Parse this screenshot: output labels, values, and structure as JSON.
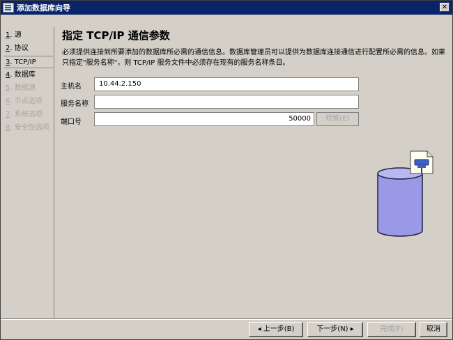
{
  "window": {
    "title": "添加数据库向导",
    "close_glyph": "✕"
  },
  "sidebar": {
    "items": [
      {
        "num": "1",
        "label": "源",
        "state": "normal"
      },
      {
        "num": "2",
        "label": "协议",
        "state": "normal"
      },
      {
        "num": "3",
        "label": "TCP/IP",
        "state": "active"
      },
      {
        "num": "4",
        "label": "数据库",
        "state": "normal"
      },
      {
        "num": "5",
        "label": "数据源",
        "state": "disabled"
      },
      {
        "num": "6",
        "label": "节点选项",
        "state": "disabled"
      },
      {
        "num": "7",
        "label": "系统选项",
        "state": "disabled"
      },
      {
        "num": "8",
        "label": "安全性选项",
        "state": "disabled"
      }
    ]
  },
  "main": {
    "heading": "指定 TCP/IP 通信参数",
    "description": "必须提供连接到所要添加的数据库所必需的通信信息。数据库管理员可以提供为数据库连接通信进行配置所必需的信息。如果只指定\"服务名称\"，则 TCP/IP 服务文件中必须存在现有的服务名称条目。",
    "hostname_label": "主机名",
    "hostname_value": "10.44.2.150",
    "service_label": "服务名称",
    "service_value": "",
    "port_label": "端口号",
    "port_value": "50000",
    "search_button": "检索(E)"
  },
  "footer": {
    "back_button": "◂ 上一步(B)",
    "next_button": "下一步(N) ▸",
    "finish_button": "完成(F)",
    "cancel_button": "取消"
  },
  "colors": {
    "titlebar": "#0a246a",
    "face": "#d4d0c8",
    "db_fill": "#9999e8",
    "db_stroke": "#202040"
  }
}
